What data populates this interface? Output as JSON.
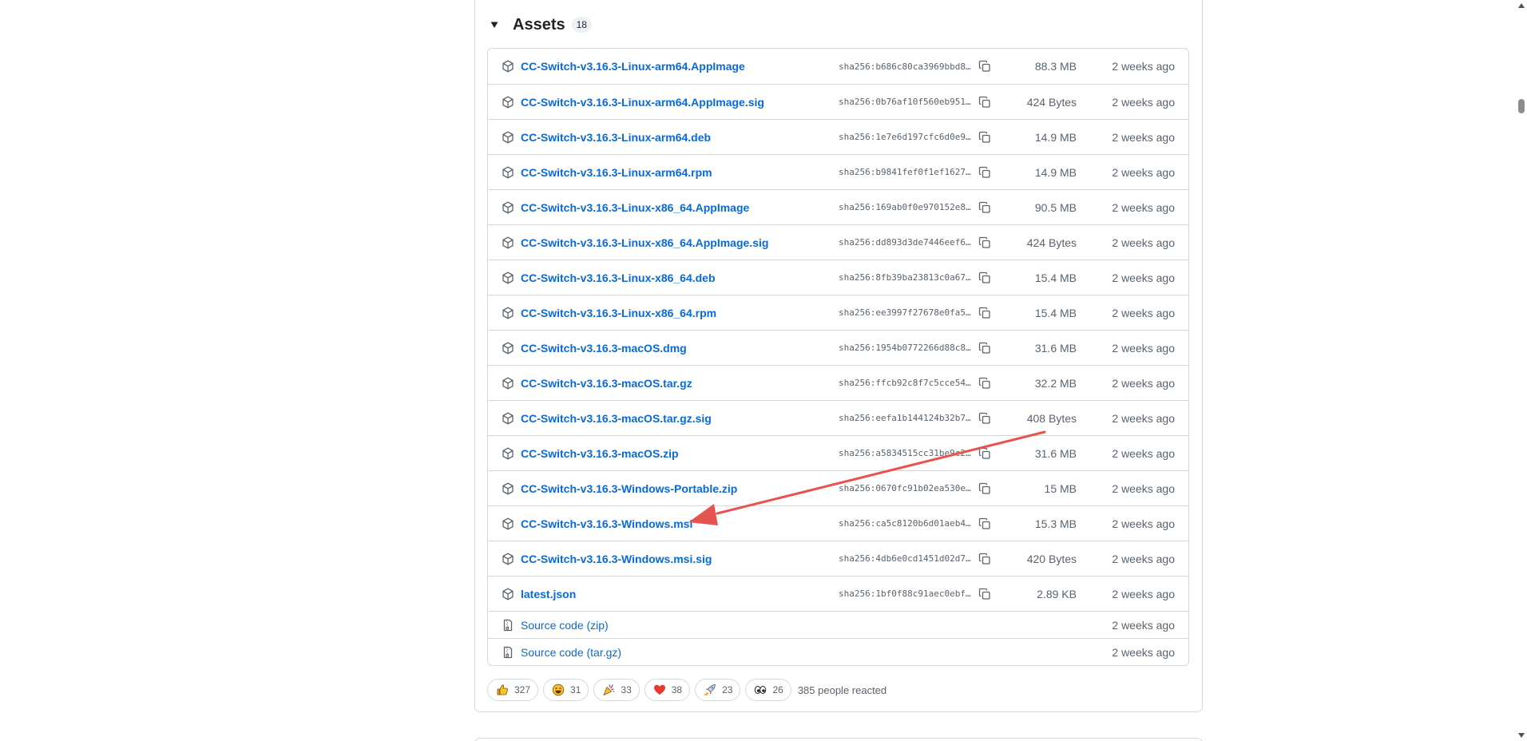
{
  "assets": {
    "title": "Assets",
    "count": "18",
    "items": [
      {
        "name": "CC-Switch-v3.16.3-Linux-arm64.AppImage",
        "sha": "sha256:b686c80ca3969bbd8…",
        "size": "88.3 MB",
        "date": "2 weeks ago"
      },
      {
        "name": "CC-Switch-v3.16.3-Linux-arm64.AppImage.sig",
        "sha": "sha256:0b76af10f560eb951…",
        "size": "424 Bytes",
        "date": "2 weeks ago"
      },
      {
        "name": "CC-Switch-v3.16.3-Linux-arm64.deb",
        "sha": "sha256:1e7e6d197cfc6d0e9…",
        "size": "14.9 MB",
        "date": "2 weeks ago"
      },
      {
        "name": "CC-Switch-v3.16.3-Linux-arm64.rpm",
        "sha": "sha256:b9841fef0f1ef1627…",
        "size": "14.9 MB",
        "date": "2 weeks ago"
      },
      {
        "name": "CC-Switch-v3.16.3-Linux-x86_64.AppImage",
        "sha": "sha256:169ab0f0e970152e8…",
        "size": "90.5 MB",
        "date": "2 weeks ago"
      },
      {
        "name": "CC-Switch-v3.16.3-Linux-x86_64.AppImage.sig",
        "sha": "sha256:dd893d3de7446eef6…",
        "size": "424 Bytes",
        "date": "2 weeks ago"
      },
      {
        "name": "CC-Switch-v3.16.3-Linux-x86_64.deb",
        "sha": "sha256:8fb39ba23813c0a67…",
        "size": "15.4 MB",
        "date": "2 weeks ago"
      },
      {
        "name": "CC-Switch-v3.16.3-Linux-x86_64.rpm",
        "sha": "sha256:ee3997f27678e0fa5…",
        "size": "15.4 MB",
        "date": "2 weeks ago"
      },
      {
        "name": "CC-Switch-v3.16.3-macOS.dmg",
        "sha": "sha256:1954b0772266d88c8…",
        "size": "31.6 MB",
        "date": "2 weeks ago"
      },
      {
        "name": "CC-Switch-v3.16.3-macOS.tar.gz",
        "sha": "sha256:ffcb92c8f7c5cce54…",
        "size": "32.2 MB",
        "date": "2 weeks ago"
      },
      {
        "name": "CC-Switch-v3.16.3-macOS.tar.gz.sig",
        "sha": "sha256:eefa1b144124b32b7…",
        "size": "408 Bytes",
        "date": "2 weeks ago"
      },
      {
        "name": "CC-Switch-v3.16.3-macOS.zip",
        "sha": "sha256:a5834515cc31be9c2…",
        "size": "31.6 MB",
        "date": "2 weeks ago"
      },
      {
        "name": "CC-Switch-v3.16.3-Windows-Portable.zip",
        "sha": "sha256:0670fc91b02ea530e…",
        "size": "15 MB",
        "date": "2 weeks ago"
      },
      {
        "name": "CC-Switch-v3.16.3-Windows.msi",
        "sha": "sha256:ca5c8120b6d01aeb4…",
        "size": "15.3 MB",
        "date": "2 weeks ago"
      },
      {
        "name": "CC-Switch-v3.16.3-Windows.msi.sig",
        "sha": "sha256:4db6e0cd1451d02d7…",
        "size": "420 Bytes",
        "date": "2 weeks ago"
      },
      {
        "name": "latest.json",
        "sha": "sha256:1bf0f88c91aec0ebf…",
        "size": "2.89 KB",
        "date": "2 weeks ago"
      }
    ],
    "sources": [
      {
        "name": "Source code",
        "format": "(zip)",
        "date": "2 weeks ago"
      },
      {
        "name": "Source code",
        "format": "(tar.gz)",
        "date": "2 weeks ago"
      }
    ]
  },
  "reactions": {
    "items": [
      {
        "icon": "thumbs-up-icon",
        "count": "327"
      },
      {
        "icon": "laugh-icon",
        "count": "31"
      },
      {
        "icon": "hooray-icon",
        "count": "33"
      },
      {
        "icon": "heart-icon",
        "count": "38"
      },
      {
        "icon": "rocket-icon",
        "count": "23"
      },
      {
        "icon": "eyes-icon",
        "count": "26"
      }
    ],
    "summary": "385 people reacted"
  },
  "colors": {
    "link": "#0969da",
    "muted": "#59636e",
    "border": "#d1d9e0",
    "annotation_arrow": "#e8534f"
  },
  "annotation": {
    "type": "arrow",
    "target": "CC-Switch-v3.16.3-Windows.msi"
  }
}
